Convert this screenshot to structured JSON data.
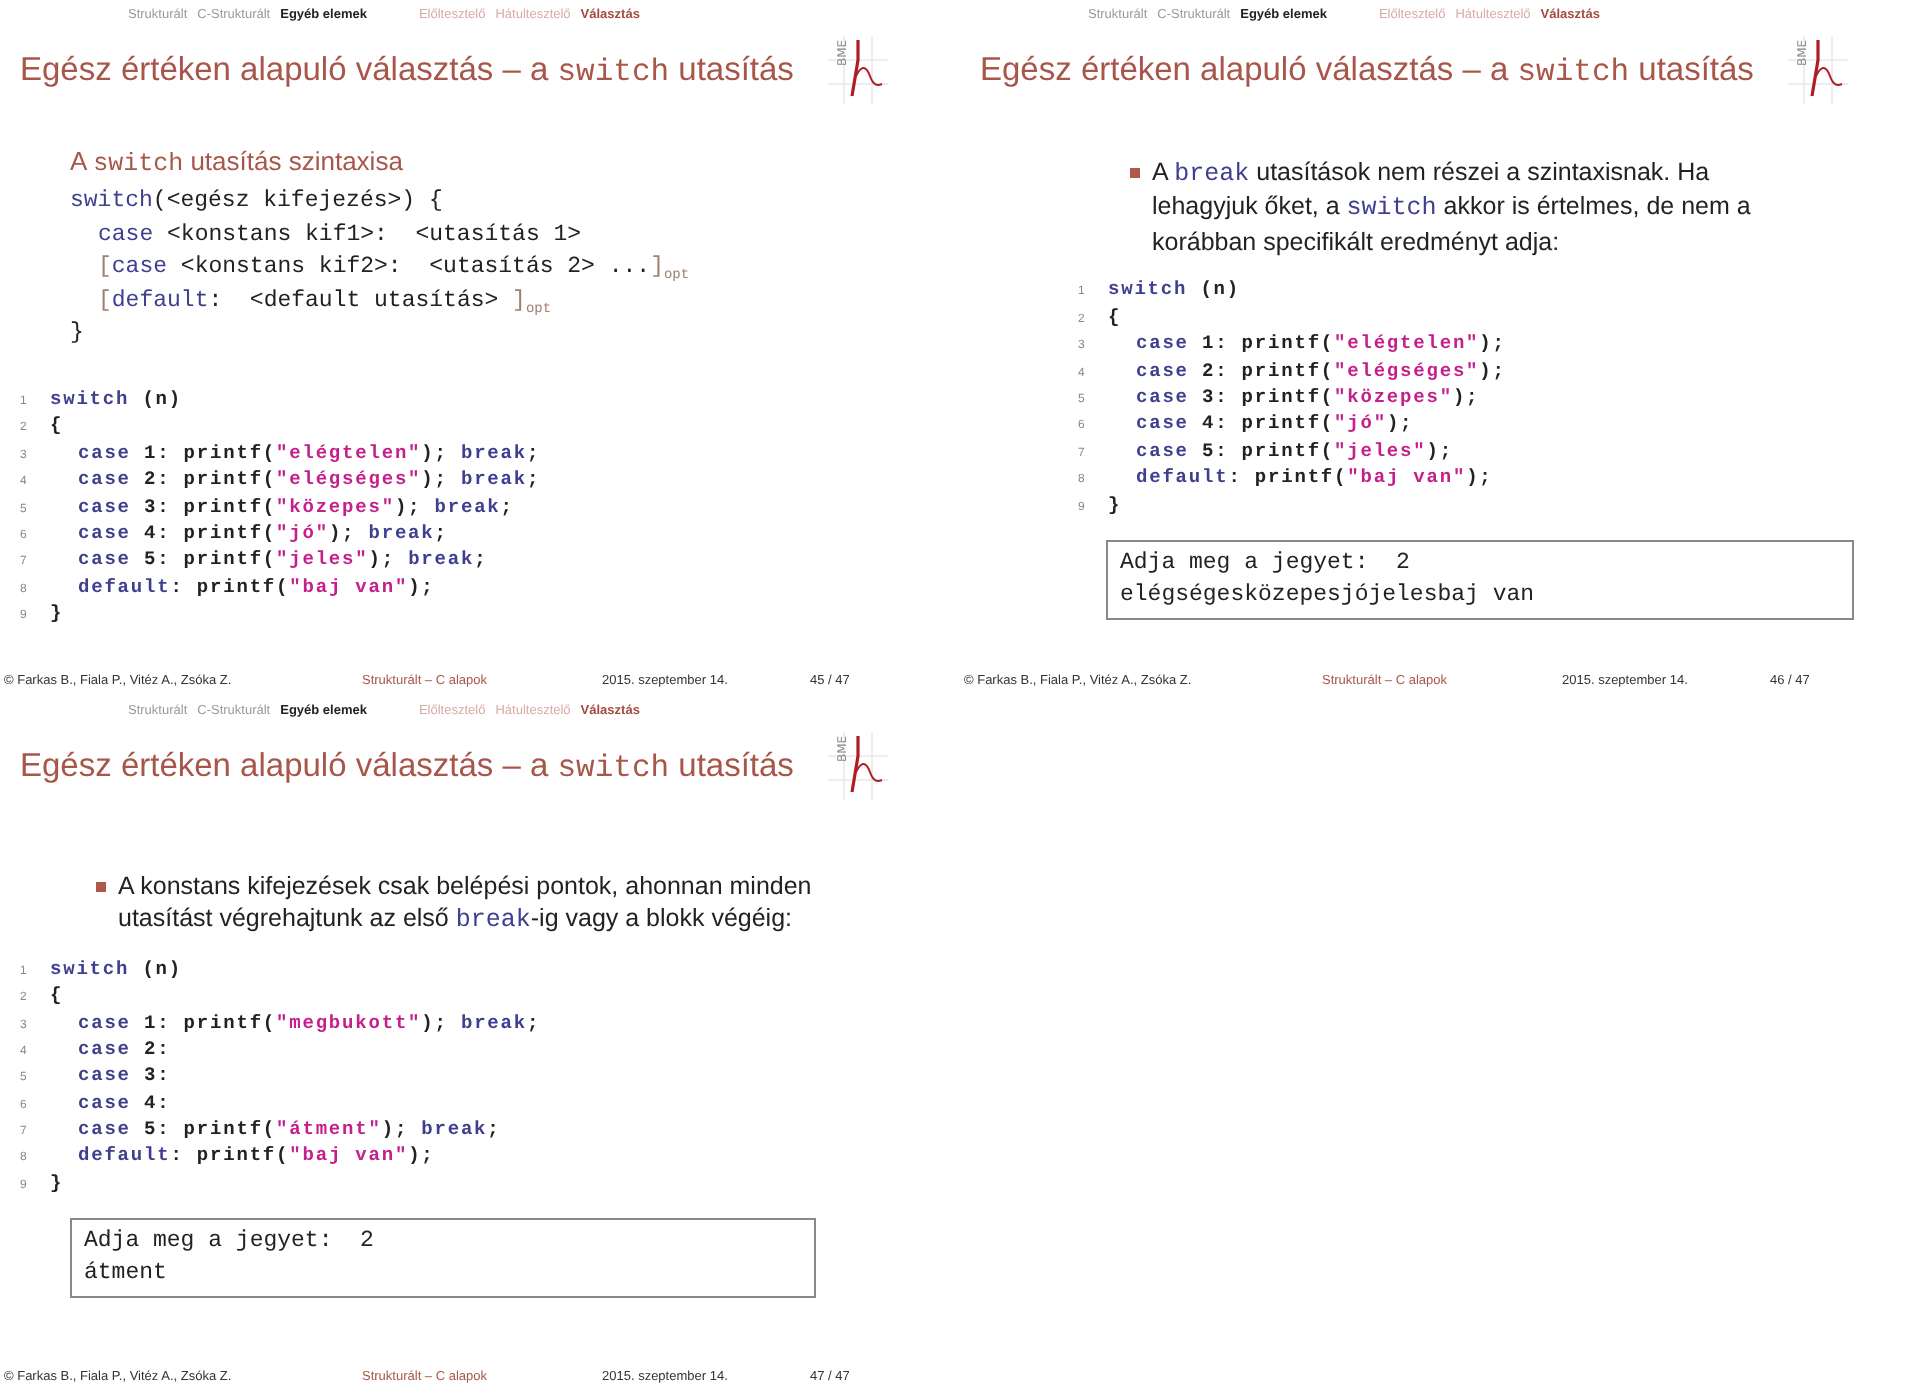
{
  "slides": [
    {
      "nav": [
        {
          "label": "Strukturált",
          "kind": "section",
          "selected": false
        },
        {
          "label": "C-Strukturált",
          "kind": "section",
          "selected": false
        },
        {
          "label": "Egyéb elemek",
          "kind": "section",
          "selected": true
        },
        {
          "label": "Előltesztelő",
          "kind": "subsection",
          "selected": false
        },
        {
          "label": "Hátultesztelő",
          "kind": "subsection",
          "selected": false
        },
        {
          "label": "Választás",
          "kind": "subsection",
          "selected": true
        }
      ],
      "title": [
        {
          "text": "Egész értéken alapuló választás – a ",
          "kind": "plain"
        },
        {
          "text": "switch",
          "kind": "code"
        },
        {
          "text": " utasítás",
          "kind": "plain"
        }
      ],
      "logo_text": "BME",
      "blocks": [
        {
          "kind": "syntax",
          "heading": [
            {
              "text": "A ",
              "kind": "plain"
            },
            {
              "text": "switch",
              "kind": "code"
            },
            {
              "text": " utasítás szintaxisa",
              "kind": "plain"
            }
          ],
          "lines": [
            {
              "parts": [
                {
                  "text": "switch",
                  "kind": "kw"
                },
                {
                  "text": "(<egész kifejezés>) {",
                  "kind": "plain"
                }
              ],
              "children": [
                {
                  "parts": [
                    {
                      "text": "case",
                      "kind": "kw"
                    },
                    {
                      "text": " <konstans kif1>:  <utasítás 1>",
                      "kind": "plain"
                    }
                  ]
                },
                {
                  "parts": [
                    {
                      "text": "[",
                      "kind": "bracket"
                    },
                    {
                      "text": "case",
                      "kind": "kw"
                    },
                    {
                      "text": " <konstans kif2>:  <utasítás 2> ...",
                      "kind": "plain"
                    },
                    {
                      "text": "]",
                      "kind": "bracket"
                    },
                    {
                      "text": "opt",
                      "kind": "sub"
                    }
                  ]
                },
                {
                  "parts": [
                    {
                      "text": "[",
                      "kind": "bracket"
                    },
                    {
                      "text": "default",
                      "kind": "kw"
                    },
                    {
                      "text": ":  <default utasítás> ",
                      "kind": "plain"
                    },
                    {
                      "text": "]",
                      "kind": "bracket"
                    },
                    {
                      "text": "opt",
                      "kind": "sub"
                    }
                  ]
                }
              ]
            },
            {
              "parts": [
                {
                  "text": "}",
                  "kind": "plain"
                }
              ]
            }
          ]
        },
        {
          "kind": "code",
          "lines": [
            {
              "number": "1",
              "parts": [
                {
                  "text": "switch",
                  "kind": "kw"
                },
                {
                  "text": " (n)",
                  "kind": "plain"
                }
              ]
            },
            {
              "number": "2",
              "parts": [
                {
                  "text": "{",
                  "kind": "plain"
                }
              ],
              "children": [
                {
                  "number": "3",
                  "parts": [
                    {
                      "text": "case",
                      "kind": "kw"
                    },
                    {
                      "text": " 1: printf(",
                      "kind": "plain"
                    },
                    {
                      "text": "\"elégtelen\"",
                      "kind": "str"
                    },
                    {
                      "text": "); ",
                      "kind": "plain"
                    },
                    {
                      "text": "break",
                      "kind": "kw"
                    },
                    {
                      "text": ";",
                      "kind": "plain"
                    }
                  ]
                },
                {
                  "number": "4",
                  "parts": [
                    {
                      "text": "case",
                      "kind": "kw"
                    },
                    {
                      "text": " 2: printf(",
                      "kind": "plain"
                    },
                    {
                      "text": "\"elégséges\"",
                      "kind": "str"
                    },
                    {
                      "text": "); ",
                      "kind": "plain"
                    },
                    {
                      "text": "break",
                      "kind": "kw"
                    },
                    {
                      "text": ";",
                      "kind": "plain"
                    }
                  ]
                },
                {
                  "number": "5",
                  "parts": [
                    {
                      "text": "case",
                      "kind": "kw"
                    },
                    {
                      "text": " 3: printf(",
                      "kind": "plain"
                    },
                    {
                      "text": "\"közepes\"",
                      "kind": "str"
                    },
                    {
                      "text": "); ",
                      "kind": "plain"
                    },
                    {
                      "text": "break",
                      "kind": "kw"
                    },
                    {
                      "text": ";",
                      "kind": "plain"
                    }
                  ]
                },
                {
                  "number": "6",
                  "parts": [
                    {
                      "text": "case",
                      "kind": "kw"
                    },
                    {
                      "text": " 4: printf(",
                      "kind": "plain"
                    },
                    {
                      "text": "\"jó\"",
                      "kind": "str"
                    },
                    {
                      "text": "); ",
                      "kind": "plain"
                    },
                    {
                      "text": "break",
                      "kind": "kw"
                    },
                    {
                      "text": ";",
                      "kind": "plain"
                    }
                  ]
                },
                {
                  "number": "7",
                  "parts": [
                    {
                      "text": "case",
                      "kind": "kw"
                    },
                    {
                      "text": " 5: printf(",
                      "kind": "plain"
                    },
                    {
                      "text": "\"jeles\"",
                      "kind": "str"
                    },
                    {
                      "text": "); ",
                      "kind": "plain"
                    },
                    {
                      "text": "break",
                      "kind": "kw"
                    },
                    {
                      "text": ";",
                      "kind": "plain"
                    }
                  ]
                },
                {
                  "number": "8",
                  "parts": [
                    {
                      "text": "default",
                      "kind": "kw"
                    },
                    {
                      "text": ": printf(",
                      "kind": "plain"
                    },
                    {
                      "text": "\"baj van\"",
                      "kind": "str"
                    },
                    {
                      "text": ");",
                      "kind": "plain"
                    }
                  ]
                }
              ]
            },
            {
              "number": "9",
              "parts": [
                {
                  "text": "}",
                  "kind": "plain"
                }
              ]
            }
          ]
        }
      ],
      "footer": {
        "authors": "© Farkas B., Fiala P., Vitéz A., Zsóka Z.",
        "course": "Strukturált – C alapok",
        "date": "2015. szeptember 14.",
        "page": "45 / 47"
      }
    },
    {
      "nav": [
        {
          "label": "Strukturált",
          "kind": "section",
          "selected": false
        },
        {
          "label": "C-Strukturált",
          "kind": "section",
          "selected": false
        },
        {
          "label": "Egyéb elemek",
          "kind": "section",
          "selected": true
        },
        {
          "label": "Előltesztelő",
          "kind": "subsection",
          "selected": false
        },
        {
          "label": "Hátultesztelő",
          "kind": "subsection",
          "selected": false
        },
        {
          "label": "Választás",
          "kind": "subsection",
          "selected": true
        }
      ],
      "title": [
        {
          "text": "Egész értéken alapuló választás – a ",
          "kind": "plain"
        },
        {
          "text": "switch",
          "kind": "code"
        },
        {
          "text": " utasítás",
          "kind": "plain"
        }
      ],
      "logo_text": "BME",
      "blocks": [
        {
          "kind": "bullet",
          "parts": [
            {
              "text": "A ",
              "kind": "plain"
            },
            {
              "text": "break",
              "kind": "code"
            },
            {
              "text": " utasítások nem részei a szintaxisnak. Ha lehagyjuk őket, a ",
              "kind": "plain"
            },
            {
              "text": "switch",
              "kind": "code"
            },
            {
              "text": " akkor is értelmes, de nem a korábban specifikált eredményt adja:",
              "kind": "plain"
            }
          ]
        },
        {
          "kind": "code",
          "lines": [
            {
              "number": "1",
              "parts": [
                {
                  "text": "switch",
                  "kind": "kw"
                },
                {
                  "text": " (n)",
                  "kind": "plain"
                }
              ]
            },
            {
              "number": "2",
              "parts": [
                {
                  "text": "{",
                  "kind": "plain"
                }
              ],
              "children": [
                {
                  "number": "3",
                  "parts": [
                    {
                      "text": "case",
                      "kind": "kw"
                    },
                    {
                      "text": " 1: printf(",
                      "kind": "plain"
                    },
                    {
                      "text": "\"elégtelen\"",
                      "kind": "str"
                    },
                    {
                      "text": ");",
                      "kind": "plain"
                    }
                  ]
                },
                {
                  "number": "4",
                  "parts": [
                    {
                      "text": "case",
                      "kind": "kw"
                    },
                    {
                      "text": " 2: printf(",
                      "kind": "plain"
                    },
                    {
                      "text": "\"elégséges\"",
                      "kind": "str"
                    },
                    {
                      "text": ");",
                      "kind": "plain"
                    }
                  ]
                },
                {
                  "number": "5",
                  "parts": [
                    {
                      "text": "case",
                      "kind": "kw"
                    },
                    {
                      "text": " 3: printf(",
                      "kind": "plain"
                    },
                    {
                      "text": "\"közepes\"",
                      "kind": "str"
                    },
                    {
                      "text": ");",
                      "kind": "plain"
                    }
                  ]
                },
                {
                  "number": "6",
                  "parts": [
                    {
                      "text": "case",
                      "kind": "kw"
                    },
                    {
                      "text": " 4: printf(",
                      "kind": "plain"
                    },
                    {
                      "text": "\"jó\"",
                      "kind": "str"
                    },
                    {
                      "text": ");",
                      "kind": "plain"
                    }
                  ]
                },
                {
                  "number": "7",
                  "parts": [
                    {
                      "text": "case",
                      "kind": "kw"
                    },
                    {
                      "text": " 5: printf(",
                      "kind": "plain"
                    },
                    {
                      "text": "\"jeles\"",
                      "kind": "str"
                    },
                    {
                      "text": ");",
                      "kind": "plain"
                    }
                  ]
                },
                {
                  "number": "8",
                  "parts": [
                    {
                      "text": "default",
                      "kind": "kw"
                    },
                    {
                      "text": ": printf(",
                      "kind": "plain"
                    },
                    {
                      "text": "\"baj van\"",
                      "kind": "str"
                    },
                    {
                      "text": ");",
                      "kind": "plain"
                    }
                  ]
                }
              ]
            },
            {
              "number": "9",
              "parts": [
                {
                  "text": "}",
                  "kind": "plain"
                }
              ]
            }
          ]
        },
        {
          "kind": "output",
          "lines": [
            "Adja meg a jegyet:  2",
            "elégségesközepesjójelesbaj van"
          ]
        }
      ],
      "footer": {
        "authors": "© Farkas B., Fiala P., Vitéz A., Zsóka Z.",
        "course": "Strukturált – C alapok",
        "date": "2015. szeptember 14.",
        "page": "46 / 47"
      }
    },
    {
      "nav": [
        {
          "label": "Strukturált",
          "kind": "section",
          "selected": false
        },
        {
          "label": "C-Strukturált",
          "kind": "section",
          "selected": false
        },
        {
          "label": "Egyéb elemek",
          "kind": "section",
          "selected": true
        },
        {
          "label": "Előltesztelő",
          "kind": "subsection",
          "selected": false
        },
        {
          "label": "Hátultesztelő",
          "kind": "subsection",
          "selected": false
        },
        {
          "label": "Választás",
          "kind": "subsection",
          "selected": true
        }
      ],
      "title": [
        {
          "text": "Egész értéken alapuló választás – a ",
          "kind": "plain"
        },
        {
          "text": "switch",
          "kind": "code"
        },
        {
          "text": " utasítás",
          "kind": "plain"
        }
      ],
      "logo_text": "BME",
      "blocks": [
        {
          "kind": "bullet",
          "parts": [
            {
              "text": "A konstans kifejezések csak belépési pontok, ahonnan minden utasítást végrehajtunk az első ",
              "kind": "plain"
            },
            {
              "text": "break",
              "kind": "code"
            },
            {
              "text": "-ig vagy a blokk végéig:",
              "kind": "plain"
            }
          ]
        },
        {
          "kind": "code",
          "lines": [
            {
              "number": "1",
              "parts": [
                {
                  "text": "switch",
                  "kind": "kw"
                },
                {
                  "text": " (n)",
                  "kind": "plain"
                }
              ]
            },
            {
              "number": "2",
              "parts": [
                {
                  "text": "{",
                  "kind": "plain"
                }
              ],
              "children": [
                {
                  "number": "3",
                  "parts": [
                    {
                      "text": "case",
                      "kind": "kw"
                    },
                    {
                      "text": " 1: printf(",
                      "kind": "plain"
                    },
                    {
                      "text": "\"megbukott\"",
                      "kind": "str"
                    },
                    {
                      "text": "); ",
                      "kind": "plain"
                    },
                    {
                      "text": "break",
                      "kind": "kw"
                    },
                    {
                      "text": ";",
                      "kind": "plain"
                    }
                  ]
                },
                {
                  "number": "4",
                  "parts": [
                    {
                      "text": "case",
                      "kind": "kw"
                    },
                    {
                      "text": " 2:",
                      "kind": "plain"
                    }
                  ]
                },
                {
                  "number": "5",
                  "parts": [
                    {
                      "text": "case",
                      "kind": "kw"
                    },
                    {
                      "text": " 3:",
                      "kind": "plain"
                    }
                  ]
                },
                {
                  "number": "6",
                  "parts": [
                    {
                      "text": "case",
                      "kind": "kw"
                    },
                    {
                      "text": " 4:",
                      "kind": "plain"
                    }
                  ]
                },
                {
                  "number": "7",
                  "parts": [
                    {
                      "text": "case",
                      "kind": "kw"
                    },
                    {
                      "text": " 5: printf(",
                      "kind": "plain"
                    },
                    {
                      "text": "\"átment\"",
                      "kind": "str"
                    },
                    {
                      "text": "); ",
                      "kind": "plain"
                    },
                    {
                      "text": "break",
                      "kind": "kw"
                    },
                    {
                      "text": ";",
                      "kind": "plain"
                    }
                  ]
                },
                {
                  "number": "8",
                  "parts": [
                    {
                      "text": "default",
                      "kind": "kw"
                    },
                    {
                      "text": ": printf(",
                      "kind": "plain"
                    },
                    {
                      "text": "\"baj van\"",
                      "kind": "str"
                    },
                    {
                      "text": ");",
                      "kind": "plain"
                    }
                  ]
                }
              ]
            },
            {
              "number": "9",
              "parts": [
                {
                  "text": "}",
                  "kind": "plain"
                }
              ]
            }
          ]
        },
        {
          "kind": "output",
          "lines": [
            "Adja meg a jegyet:  2",
            "átment"
          ]
        }
      ],
      "footer": {
        "authors": "© Farkas B., Fiala P., Vitéz A., Zsóka Z.",
        "course": "Strukturált – C alapok",
        "date": "2015. szeptember 14.",
        "page": "47 / 47"
      }
    }
  ]
}
